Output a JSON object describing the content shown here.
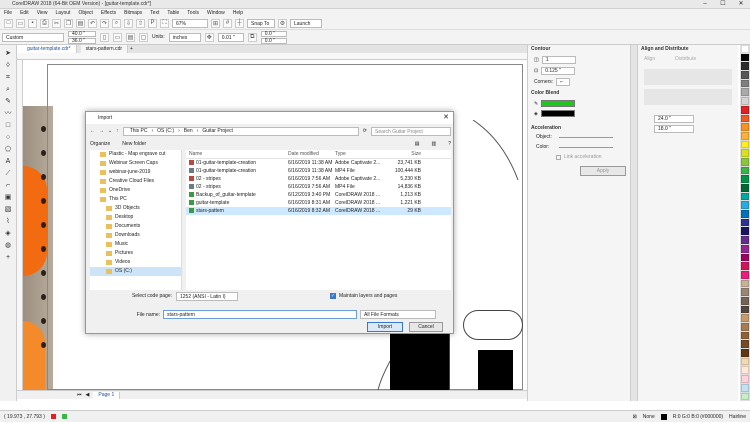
{
  "window": {
    "title": "CorelDRAW 2018 (64-Bit OEM Version) - [guitar-template.cdr*]"
  },
  "menu": [
    "File",
    "Edit",
    "View",
    "Layout",
    "Object",
    "Effects",
    "Bitmaps",
    "Text",
    "Table",
    "Tools",
    "Window",
    "Help"
  ],
  "toolbar": {
    "zoom": "67%",
    "snap_to": "Snap To",
    "launch": "Launch"
  },
  "propbar": {
    "preset": "Custom",
    "width": "40.0 \"",
    "height": "36.0 \"",
    "units_label": "Units:",
    "units": "inches",
    "nudge": "0.01 \"",
    "dup_x": "0.0 \"",
    "dup_y": "0.0 \""
  },
  "doc_tabs": [
    {
      "label": "guitar-template.cdr*",
      "active": true
    },
    {
      "label": "stars-pattern.cdr",
      "active": false
    }
  ],
  "page_tab": "Page 1",
  "dialog": {
    "title": "Import",
    "path": [
      "This PC",
      "OS (C:)",
      "Ben",
      "Guitar Project"
    ],
    "search_placeholder": "Search Guitar Project",
    "organize": "Organize",
    "new_folder": "New folder",
    "nav": [
      {
        "label": "Plastic - Map engrave cut",
        "selected": false
      },
      {
        "label": "Webinar Screen Caps",
        "selected": false
      },
      {
        "label": "webinar-june-2019",
        "selected": false
      },
      {
        "label": "Creative Cloud Files",
        "selected": false
      },
      {
        "label": "OneDrive",
        "selected": false
      },
      {
        "label": "This PC",
        "selected": false
      },
      {
        "label": "3D Objects",
        "selected": false
      },
      {
        "label": "Desktop",
        "selected": false
      },
      {
        "label": "Documents",
        "selected": false
      },
      {
        "label": "Downloads",
        "selected": false
      },
      {
        "label": "Music",
        "selected": false
      },
      {
        "label": "Pictures",
        "selected": false
      },
      {
        "label": "Videos",
        "selected": false
      },
      {
        "label": "OS (C:)",
        "selected": true
      }
    ],
    "columns": [
      "Name",
      "Date modified",
      "Type",
      "Size"
    ],
    "files": [
      {
        "name": "01-guitar-template-creation",
        "date": "6/16/2019 11:38 AM",
        "type": "Adobe Captivate 2...",
        "size": "23,741 KB",
        "kind": "cap"
      },
      {
        "name": "01-guitar-template-creation",
        "date": "6/16/2019 11:38 AM",
        "type": "MP4 File",
        "size": "100,444 KB",
        "kind": "mp4"
      },
      {
        "name": "02 - stripes",
        "date": "6/16/2019 7:56 AM",
        "type": "Adobe Captivate 2...",
        "size": "5,230 KB",
        "kind": "cap"
      },
      {
        "name": "02 - stripes",
        "date": "6/16/2019 7:56 AM",
        "type": "MP4 File",
        "size": "14,836 KB",
        "kind": "mp4"
      },
      {
        "name": "Backup_of_guitar-template",
        "date": "6/12/2019 3:40 PM",
        "type": "CorelDRAW 2018 ...",
        "size": "1,213 KB",
        "kind": "cdr"
      },
      {
        "name": "guitar-template",
        "date": "6/16/2019 8:31 AM",
        "type": "CorelDRAW 2018 ...",
        "size": "1,221 KB",
        "kind": "cdr"
      },
      {
        "name": "stars-pattern",
        "date": "6/16/2019 8:32 AM",
        "type": "CorelDRAW 2018 ...",
        "size": "29 KB",
        "kind": "cdr",
        "selected": true
      }
    ],
    "code_page_label": "Select code page:",
    "code_page": "1252  (ANSI - Latin I)",
    "maintain_layers": "Maintain layers and pages",
    "file_name_label": "File name:",
    "file_name": "stars-pattern",
    "file_type": "All File Formats",
    "import_btn": "Import",
    "cancel_btn": "Cancel"
  },
  "contour": {
    "title": "Contour",
    "steps": "1",
    "offset": "0.125 \"",
    "corners_label": "Corners:",
    "color_blend_title": "Color Blend",
    "outline_color": "#21c521",
    "fill_color": "#000000",
    "accel_title": "Acceleration",
    "object_label": "Object:",
    "color_label": "Color:",
    "link_label": "Link acceleration",
    "apply": "Apply"
  },
  "align": {
    "title": "Align and Distribute",
    "align_label": "Align",
    "distribute_label": "Distribute",
    "w": "24.0 \"",
    "h": "18.0 \""
  },
  "status": {
    "coords": "( 19.973 , 27.793 )",
    "fill": "None",
    "outline": "R:0 G:0 B:0 (#000000)",
    "outline_width": "Hairline"
  },
  "palette": [
    "#ffffff",
    "#000000",
    "#2b2b2b",
    "#555555",
    "#7f7f7f",
    "#aaaaaa",
    "#d4d4d4",
    "#e31e24",
    "#f15a24",
    "#f7931e",
    "#fbb03b",
    "#fcee21",
    "#d9e021",
    "#8cc63f",
    "#39b54a",
    "#009245",
    "#006837",
    "#00a99d",
    "#29abe2",
    "#0071bc",
    "#2e3192",
    "#1b1464",
    "#662d91",
    "#93278f",
    "#9e005d",
    "#d4145a",
    "#ed1e79",
    "#c7b299",
    "#998675",
    "#736357",
    "#534741",
    "#c69c6d",
    "#a67c52",
    "#8c6239",
    "#754c24",
    "#603813",
    "#f0dbb3",
    "#ffe8d6",
    "#ffd1dc",
    "#c4e0f5",
    "#c8f0c8"
  ]
}
